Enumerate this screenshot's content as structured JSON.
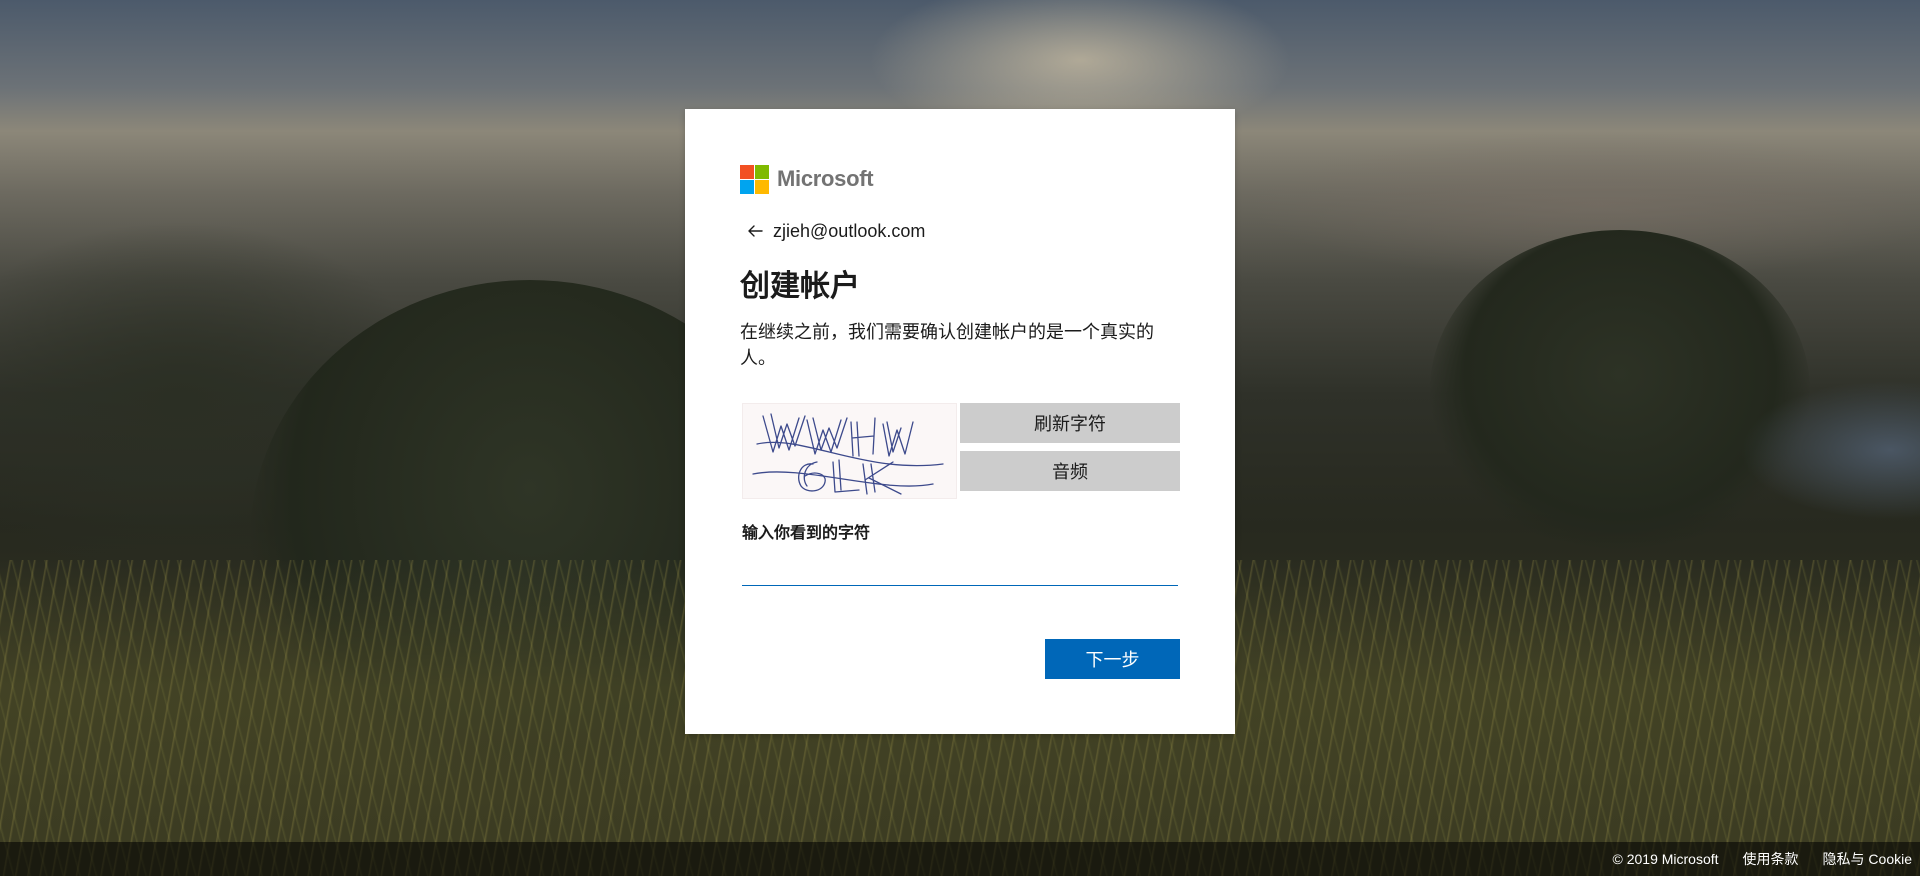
{
  "brand": {
    "name": "Microsoft",
    "logo_colors": [
      "#f25022",
      "#7fba00",
      "#00a4ef",
      "#ffb900"
    ]
  },
  "identity": {
    "email": "zjieh@outlook.com",
    "back_icon": "arrow-left-icon"
  },
  "page": {
    "title": "创建帐户",
    "description": "在继续之前，我们需要确认创建帐户的是一个真实的人。"
  },
  "captcha": {
    "image_text": "WWHM 6LK",
    "refresh_label": "刷新字符",
    "audio_label": "音频",
    "input_label": "输入你看到的字符",
    "input_value": "",
    "input_placeholder": ""
  },
  "actions": {
    "next_label": "下一步"
  },
  "footer": {
    "copyright": "© 2019 Microsoft",
    "terms": "使用条款",
    "privacy": "隐私与 Cookie"
  },
  "colors": {
    "primary": "#0067b8",
    "secondary_button": "#cccccc",
    "text": "#1b1b1b",
    "logo_text": "#737373"
  }
}
